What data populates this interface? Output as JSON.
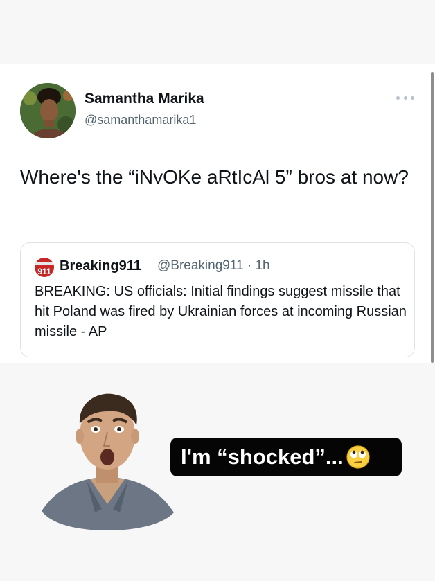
{
  "tweet": {
    "author_name": "Samantha Marika",
    "author_handle": "@samanthamarika1",
    "text": "Where's the “iNvOKe aRtIcAl 5” bros at now?"
  },
  "quoted_tweet": {
    "logo_text": "911",
    "author_name": "Breaking911",
    "meta": "@Breaking911 · 1h",
    "text": "BREAKING: US officials: Initial findings suggest missile that hit Poland was fired by Ukrainian forces at incoming Russian missile - AP"
  },
  "meme": {
    "caption": "I'm “shocked”...",
    "emoji": "face-with-rolling-eyes-icon"
  },
  "colors": {
    "background": "#f7f7f7",
    "card": "#ffffff",
    "handle_gray": "#536471",
    "caption_bg": "#050505",
    "logo_red": "#c62828"
  }
}
